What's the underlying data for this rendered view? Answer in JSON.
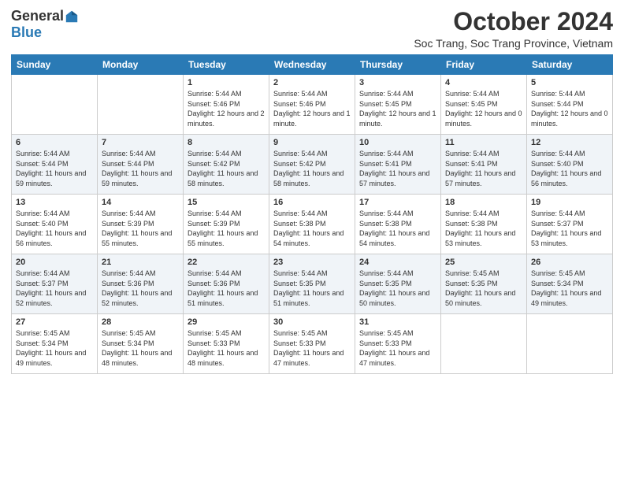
{
  "header": {
    "logo_general": "General",
    "logo_blue": "Blue",
    "month_title": "October 2024",
    "location": "Soc Trang, Soc Trang Province, Vietnam"
  },
  "days_of_week": [
    "Sunday",
    "Monday",
    "Tuesday",
    "Wednesday",
    "Thursday",
    "Friday",
    "Saturday"
  ],
  "weeks": [
    [
      {
        "day": "",
        "info": ""
      },
      {
        "day": "",
        "info": ""
      },
      {
        "day": "1",
        "info": "Sunrise: 5:44 AM\nSunset: 5:46 PM\nDaylight: 12 hours and 2 minutes."
      },
      {
        "day": "2",
        "info": "Sunrise: 5:44 AM\nSunset: 5:46 PM\nDaylight: 12 hours and 1 minute."
      },
      {
        "day": "3",
        "info": "Sunrise: 5:44 AM\nSunset: 5:45 PM\nDaylight: 12 hours and 1 minute."
      },
      {
        "day": "4",
        "info": "Sunrise: 5:44 AM\nSunset: 5:45 PM\nDaylight: 12 hours and 0 minutes."
      },
      {
        "day": "5",
        "info": "Sunrise: 5:44 AM\nSunset: 5:44 PM\nDaylight: 12 hours and 0 minutes."
      }
    ],
    [
      {
        "day": "6",
        "info": "Sunrise: 5:44 AM\nSunset: 5:44 PM\nDaylight: 11 hours and 59 minutes."
      },
      {
        "day": "7",
        "info": "Sunrise: 5:44 AM\nSunset: 5:44 PM\nDaylight: 11 hours and 59 minutes."
      },
      {
        "day": "8",
        "info": "Sunrise: 5:44 AM\nSunset: 5:42 PM\nDaylight: 11 hours and 58 minutes."
      },
      {
        "day": "9",
        "info": "Sunrise: 5:44 AM\nSunset: 5:42 PM\nDaylight: 11 hours and 58 minutes."
      },
      {
        "day": "10",
        "info": "Sunrise: 5:44 AM\nSunset: 5:41 PM\nDaylight: 11 hours and 57 minutes."
      },
      {
        "day": "11",
        "info": "Sunrise: 5:44 AM\nSunset: 5:41 PM\nDaylight: 11 hours and 57 minutes."
      },
      {
        "day": "12",
        "info": "Sunrise: 5:44 AM\nSunset: 5:40 PM\nDaylight: 11 hours and 56 minutes."
      }
    ],
    [
      {
        "day": "13",
        "info": "Sunrise: 5:44 AM\nSunset: 5:40 PM\nDaylight: 11 hours and 56 minutes."
      },
      {
        "day": "14",
        "info": "Sunrise: 5:44 AM\nSunset: 5:39 PM\nDaylight: 11 hours and 55 minutes."
      },
      {
        "day": "15",
        "info": "Sunrise: 5:44 AM\nSunset: 5:39 PM\nDaylight: 11 hours and 55 minutes."
      },
      {
        "day": "16",
        "info": "Sunrise: 5:44 AM\nSunset: 5:38 PM\nDaylight: 11 hours and 54 minutes."
      },
      {
        "day": "17",
        "info": "Sunrise: 5:44 AM\nSunset: 5:38 PM\nDaylight: 11 hours and 54 minutes."
      },
      {
        "day": "18",
        "info": "Sunrise: 5:44 AM\nSunset: 5:38 PM\nDaylight: 11 hours and 53 minutes."
      },
      {
        "day": "19",
        "info": "Sunrise: 5:44 AM\nSunset: 5:37 PM\nDaylight: 11 hours and 53 minutes."
      }
    ],
    [
      {
        "day": "20",
        "info": "Sunrise: 5:44 AM\nSunset: 5:37 PM\nDaylight: 11 hours and 52 minutes."
      },
      {
        "day": "21",
        "info": "Sunrise: 5:44 AM\nSunset: 5:36 PM\nDaylight: 11 hours and 52 minutes."
      },
      {
        "day": "22",
        "info": "Sunrise: 5:44 AM\nSunset: 5:36 PM\nDaylight: 11 hours and 51 minutes."
      },
      {
        "day": "23",
        "info": "Sunrise: 5:44 AM\nSunset: 5:35 PM\nDaylight: 11 hours and 51 minutes."
      },
      {
        "day": "24",
        "info": "Sunrise: 5:44 AM\nSunset: 5:35 PM\nDaylight: 11 hours and 50 minutes."
      },
      {
        "day": "25",
        "info": "Sunrise: 5:45 AM\nSunset: 5:35 PM\nDaylight: 11 hours and 50 minutes."
      },
      {
        "day": "26",
        "info": "Sunrise: 5:45 AM\nSunset: 5:34 PM\nDaylight: 11 hours and 49 minutes."
      }
    ],
    [
      {
        "day": "27",
        "info": "Sunrise: 5:45 AM\nSunset: 5:34 PM\nDaylight: 11 hours and 49 minutes."
      },
      {
        "day": "28",
        "info": "Sunrise: 5:45 AM\nSunset: 5:34 PM\nDaylight: 11 hours and 48 minutes."
      },
      {
        "day": "29",
        "info": "Sunrise: 5:45 AM\nSunset: 5:33 PM\nDaylight: 11 hours and 48 minutes."
      },
      {
        "day": "30",
        "info": "Sunrise: 5:45 AM\nSunset: 5:33 PM\nDaylight: 11 hours and 47 minutes."
      },
      {
        "day": "31",
        "info": "Sunrise: 5:45 AM\nSunset: 5:33 PM\nDaylight: 11 hours and 47 minutes."
      },
      {
        "day": "",
        "info": ""
      },
      {
        "day": "",
        "info": ""
      }
    ]
  ]
}
